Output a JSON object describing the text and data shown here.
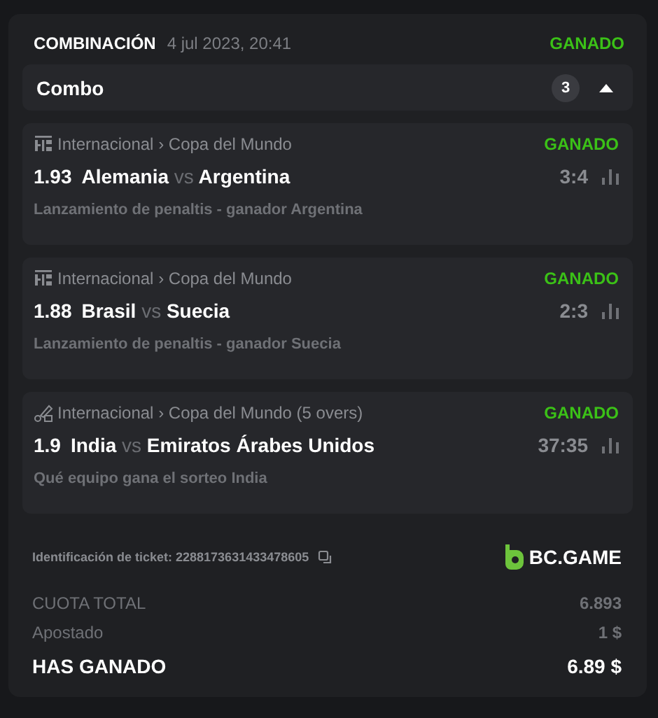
{
  "header": {
    "title": "COMBINACIÓN",
    "date": "4 jul 2023, 20:41",
    "status": "GANADO"
  },
  "combo": {
    "label": "Combo",
    "count": "3",
    "expanded": true
  },
  "bets": [
    {
      "kind": "football",
      "league": "Internacional",
      "separator": "›",
      "competition": "Copa del Mundo",
      "status": "GANADO",
      "odds": "1.93",
      "home": "Alemania",
      "vs": "vs",
      "away": "Argentina",
      "score": "3:4",
      "market": "Lanzamiento de penaltis - ganador Argentina"
    },
    {
      "kind": "football",
      "league": "Internacional",
      "separator": "›",
      "competition": "Copa del Mundo",
      "status": "GANADO",
      "odds": "1.88",
      "home": "Brasil",
      "vs": "vs",
      "away": "Suecia",
      "score": "2:3",
      "market": "Lanzamiento de penaltis - ganador Suecia"
    },
    {
      "kind": "cricket",
      "league": "Internacional",
      "separator": "›",
      "competition": "Copa del Mundo (5 overs)",
      "status": "GANADO",
      "odds": "1.9",
      "home": "India",
      "vs": "vs",
      "away": "Emiratos Árabes Unidos",
      "score": "37:35",
      "market": "Qué equipo gana el sorteo India"
    }
  ],
  "ticket": {
    "label": "Identificación de ticket: 2288173631433478605",
    "brand": "BC.GAME"
  },
  "totals": [
    {
      "kind": "muted",
      "label": "CUOTA TOTAL",
      "value": "6.893"
    },
    {
      "kind": "muted",
      "label": "Apostado",
      "value": "1 $"
    },
    {
      "kind": "strong",
      "label": "HAS GANADO",
      "value": "6.89 $"
    }
  ]
}
